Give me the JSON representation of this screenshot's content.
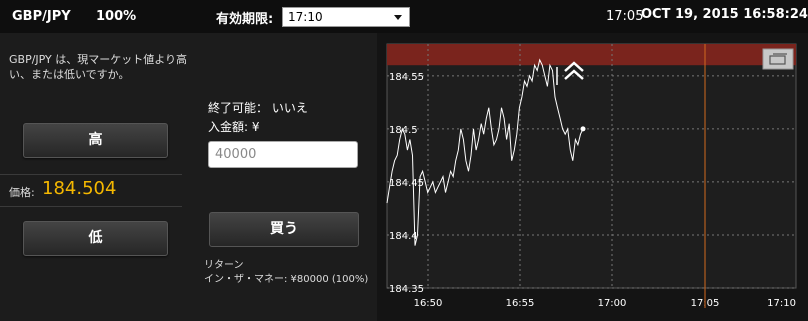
{
  "topbar": {
    "symbol": "GBP/JPY",
    "percent": "100%",
    "expiry_label": "有効期限:",
    "expiry_selected": "17:10",
    "time": "17:05",
    "datetime": "OCT 19, 2015 16:58:24"
  },
  "left": {
    "question": "GBP/JPY は、現マーケット値より高い、または低いですか。",
    "high_label": "高",
    "price_label": "価格:",
    "price_value": "184.504",
    "low_label": "低"
  },
  "middle": {
    "end_possible": "終了可能：  いいえ",
    "deposit_label": "入金額: ¥",
    "deposit_value": "40000",
    "buy_label": "買う",
    "return_label": "リターン",
    "in_the_money": "イン・ザ・マネー: ¥80000 (100%)"
  },
  "chart_data": {
    "type": "line",
    "y_ticks": [
      "184.55",
      "184.5",
      "184.45",
      "184.4",
      "184.35"
    ],
    "x_ticks": [
      "16:50",
      "16:55",
      "17:00",
      "17:05",
      "17:10"
    ],
    "ylim": [
      184.35,
      184.58
    ],
    "expiry_marker": "17:05",
    "barrier_above": 184.56,
    "series": [
      {
        "values": [
          184.43,
          184.445,
          184.46,
          184.47,
          184.475,
          184.49,
          184.5,
          184.495,
          184.48,
          184.49,
          184.475,
          184.39,
          184.4,
          184.455,
          184.46,
          184.45,
          184.44,
          184.445,
          184.45,
          184.44,
          184.445,
          184.45,
          184.455,
          184.44,
          184.45,
          184.46,
          184.455,
          184.47,
          184.48,
          184.5,
          184.49,
          184.47,
          184.46,
          184.475,
          184.5,
          184.48,
          184.49,
          184.505,
          184.495,
          184.51,
          184.52,
          184.5,
          184.485,
          184.49,
          184.5,
          184.52,
          184.51,
          184.49,
          184.505,
          184.47,
          184.48,
          184.495,
          184.52,
          184.53,
          184.545,
          184.54,
          184.55,
          184.545,
          184.56,
          184.555,
          184.565,
          184.56,
          184.55,
          184.54,
          184.56,
          184.555,
          184.53,
          184.52,
          184.51,
          184.5,
          184.495,
          184.5,
          184.48,
          184.47,
          184.49,
          184.485,
          184.495,
          184.5
        ]
      }
    ]
  }
}
